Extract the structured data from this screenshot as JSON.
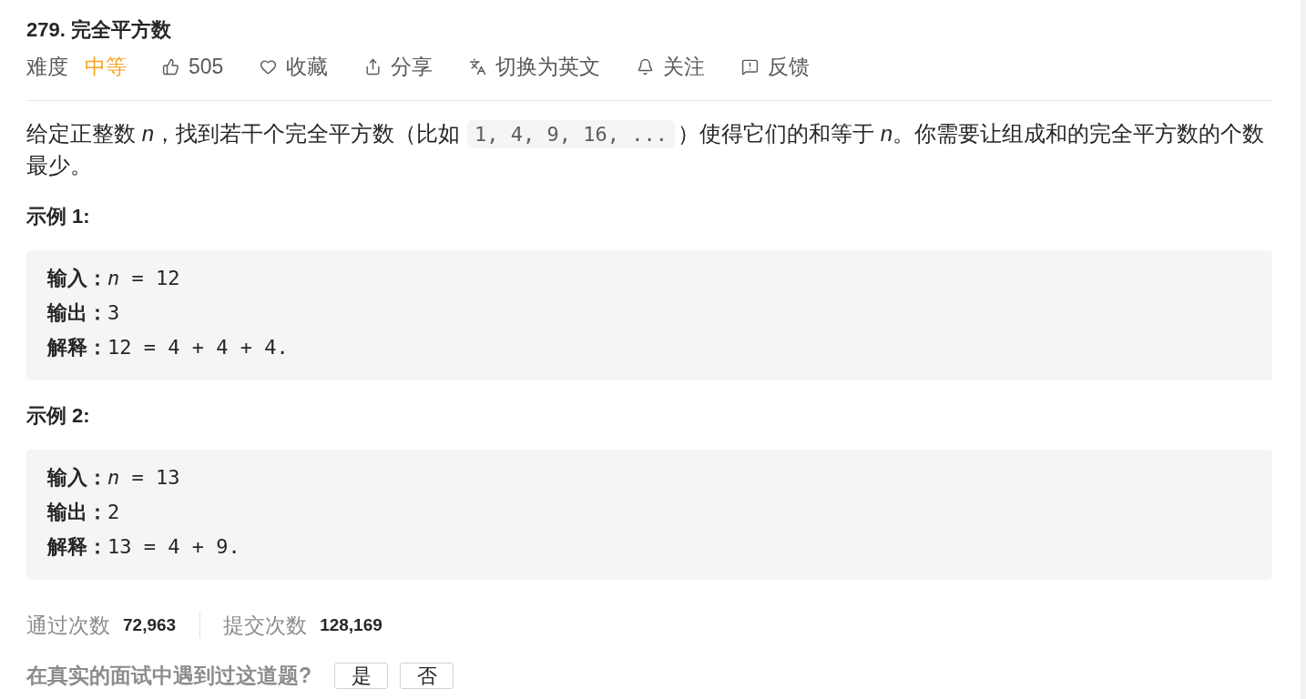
{
  "problem": {
    "title": "279. 完全平方数"
  },
  "toolbar": {
    "difficulty": {
      "label": "难度",
      "value": "中等",
      "kind": "medium"
    },
    "actions": [
      {
        "kind": "like",
        "label": "505"
      },
      {
        "kind": "favorite",
        "label": "收藏"
      },
      {
        "kind": "share",
        "label": "分享"
      },
      {
        "kind": "translate",
        "label": "切换为英文"
      },
      {
        "kind": "follow",
        "label": "关注"
      },
      {
        "kind": "feedback",
        "label": "反馈"
      }
    ]
  },
  "description": [
    {
      "kind": "text",
      "text": "给定正整数 *n*，找到若干个完全平方数（比如"
    },
    {
      "kind": "code",
      "text": "1, 4, 9, 16, ..."
    },
    {
      "kind": "text",
      "text": "）使得它们的和等于 *n*。你需要让组成和的完全平方数的个数最少。"
    }
  ],
  "examples": [
    {
      "title": "示例 1:",
      "lines": [
        {
          "label": "输入：",
          "value": "*n* = 12"
        },
        {
          "label": "输出：",
          "value": "3"
        },
        {
          "label": "解释：",
          "value": "12 = 4 + 4 + 4."
        }
      ]
    },
    {
      "title": "示例 2:",
      "lines": [
        {
          "label": "输入：",
          "value": "*n* = 13"
        },
        {
          "label": "输出：",
          "value": "2"
        },
        {
          "label": "解释：",
          "value": "13 = 4 + 9."
        }
      ]
    }
  ],
  "stats": [
    {
      "label": "通过次数",
      "value": "72,963"
    },
    {
      "label": "提交次数",
      "value": "128,169"
    }
  ],
  "interview_question": {
    "text": "在真实的面试中遇到过这道题?",
    "buttons": [
      "是",
      "否"
    ]
  }
}
